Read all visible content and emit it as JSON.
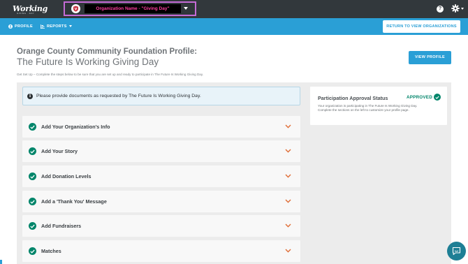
{
  "topbar": {
    "logo_text": "Working",
    "logo_sub": "GIVING · DAY",
    "org_selector": {
      "name": "Organization Name - \"Giving Day\""
    },
    "help_label": "?"
  },
  "nav": {
    "items": [
      {
        "label": "PROFILE",
        "icon": "user-circle-icon"
      },
      {
        "label": "REPORTS",
        "icon": "chart-icon"
      }
    ],
    "return_button": "RETURN TO VIEW ORGANIZATIONS"
  },
  "header": {
    "title_line1": "Orange County Community Foundation Profile:",
    "title_line2": "The Future Is Working Giving Day",
    "subtitle": "Get Set Up – Complete the steps below to be sure that you are set up and ready to participate in The Future Is Working Giving Day.",
    "view_profile_button": "VIEW PROFILE"
  },
  "info_banner": {
    "icon": "info-icon",
    "text": "Please provide documents as requested by The Future Is Working Giving Day."
  },
  "setup_steps": [
    {
      "label": "Add Your Organization's Info",
      "completed": true
    },
    {
      "label": "Add Your Story",
      "completed": true
    },
    {
      "label": "Add Donation Levels",
      "completed": true
    },
    {
      "label": "Add a 'Thank You' Message",
      "completed": true
    },
    {
      "label": "Add Fundraisers",
      "completed": true
    },
    {
      "label": "Matches",
      "completed": true
    }
  ],
  "status_card": {
    "title": "Participation Approval Status",
    "status": "APPROVED",
    "desc_line1": "Your organization is participating in The Future Is Working Giving Day.",
    "desc_line2": "Complete the sections on the left to customize your profile page."
  },
  "colors": {
    "topbar": "#32383c",
    "nav": "#2a9fd6",
    "accent_green": "#00856a",
    "chevron": "#e0703a",
    "highlight": "#c56bd6"
  }
}
